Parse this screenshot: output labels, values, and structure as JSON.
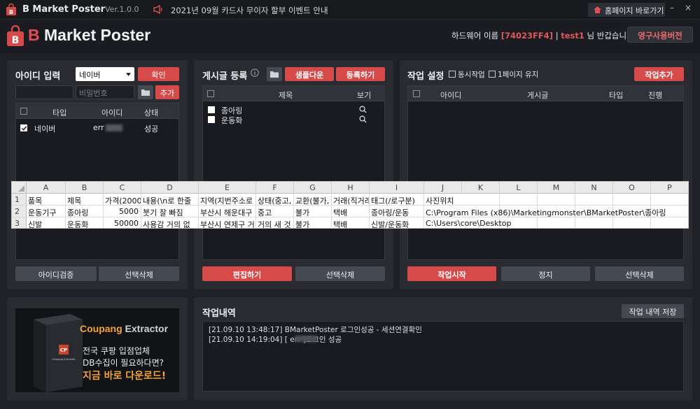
{
  "titlebar": {
    "app_name": "B Market Poster",
    "version": "Ver.1.0.0",
    "notice": "2021년 09월 카드사 무이자 할부 이벤트 안내",
    "home_label": "홈페이지 바로가기",
    "minimize": "–",
    "close": "×"
  },
  "header": {
    "logo_b": "B",
    "logo_rest": " Market Poster",
    "hw_label": "하드웨어 이름",
    "hw_value": "[74023FF4]",
    "sep": "|",
    "user": "test1",
    "greeting": "님 반갑습니다!",
    "upgrade_label": "영구사용버전"
  },
  "id_panel": {
    "title": "아이디 입력",
    "platform_value": "네이버",
    "confirm_label": "확인",
    "id_placeholder": "",
    "pw_placeholder": "비밀번호",
    "add_label": "추가",
    "columns": [
      "타입",
      "아이디",
      "상태"
    ],
    "rows": [
      {
        "type": "네이버",
        "id": "err",
        "status": "성공"
      }
    ],
    "verify_label": "아이디검증",
    "delete_label": "선택삭제"
  },
  "post_panel": {
    "title": "게시글 등록",
    "sample_label": "샘플다운",
    "register_label": "등록하기",
    "columns": [
      "제목",
      "보기"
    ],
    "rows": [
      {
        "title": "종아링"
      },
      {
        "title": "운동화"
      }
    ],
    "edit_label": "편집하기",
    "delete_label": "선택삭제"
  },
  "task_panel": {
    "title": "작업 설정",
    "opt_simultaneous": "동시작업",
    "opt_keep_page": "1페이지 유지",
    "add_task_label": "작업추가",
    "columns": [
      "아이디",
      "게시글",
      "타입",
      "진행"
    ],
    "start_label": "작업시작",
    "stop_label": "정지",
    "delete_label": "선택삭제"
  },
  "history_panel": {
    "title": "작업내역",
    "save_label": "작업 내역 저장",
    "logs": [
      "[21.09.10 13:48:17]   BMarketPoster 로그인성공 - 세션연결확인",
      "[21.09.10 14:19:04]   [ err            ]로그인 성공"
    ]
  },
  "ad": {
    "brand_coupang": "Coupang",
    "brand_extractor": " Extractor",
    "line1": "전국 쿠팡 입점업체",
    "line2": "DB수집이 필요하다면?",
    "line3": "지금 바로 다운로드!",
    "box_logo": "CP",
    "box_label": "Coupang Extractor"
  },
  "excel": {
    "col_headers": [
      "A",
      "B",
      "C",
      "D",
      "E",
      "F",
      "G",
      "H",
      "I",
      "J",
      "K",
      "L",
      "M",
      "N",
      "O",
      "P"
    ],
    "row_numbers": [
      "1",
      "2",
      "3"
    ],
    "rows": [
      [
        "품목",
        "제목",
        "가격(2000",
        "내용(\\n로 한줄",
        "지역(지번주소로",
        "상태(중고,",
        "교환(불가,",
        "거래(직거래",
        "태그(/로구분)",
        "사진위치",
        "",
        "",
        "",
        "",
        "",
        ""
      ],
      [
        "운동기구",
        "종아링",
        "5000",
        "붓기 잘 빠짐",
        "부산시 해운대구",
        "중고",
        "불가",
        "택배",
        "종아링/운동",
        "C:\\Program Files (x86)\\Marketingmonster\\BMarketPoster\\종아링",
        "",
        "",
        "",
        "",
        "",
        ""
      ],
      [
        "신발",
        "운동화",
        "50000",
        "사용감 거의 없",
        "부산시 연제구 거",
        "거의 새 것",
        "불가",
        "택배",
        "신발/운동화",
        "C:\\Users\\core\\Desktop",
        "",
        "",
        "",
        "",
        "",
        ""
      ]
    ]
  },
  "colors": {
    "accent_red": "#d64a4a",
    "panel_bg": "#292b31",
    "app_bg": "#1f2127"
  }
}
